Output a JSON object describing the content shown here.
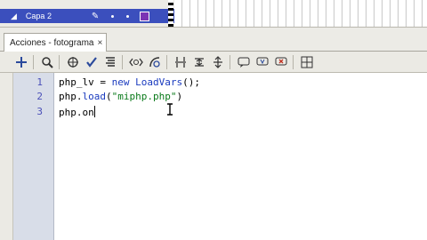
{
  "timeline": {
    "layer_name": "Capa 2"
  },
  "panel": {
    "tab_label": "Acciones - fotograma",
    "tab_close": "×"
  },
  "toolbar": {
    "icons": [
      "add-statement-icon",
      "find-icon",
      "target-icon",
      "check-syntax-icon",
      "auto-format-icon",
      "code-hint-icon",
      "debug-options-icon",
      "collapse-braces-icon",
      "collapse-selection-icon",
      "expand-all-icon",
      "apply-block-comment-icon",
      "apply-line-comment-icon",
      "remove-comment-icon",
      "show-toolbox-icon"
    ]
  },
  "editor": {
    "lines": [
      {
        "num": "1",
        "parts": [
          "php_lv",
          " = ",
          "new",
          " ",
          "LoadVars",
          "();"
        ]
      },
      {
        "num": "2",
        "parts": [
          "php.",
          "load",
          "(",
          "\"miphp.php\"",
          ")"
        ]
      },
      {
        "num": "3",
        "parts": [
          "php.on"
        ]
      }
    ]
  },
  "colors": {
    "layer_highlight": "#3b4fbd",
    "keyword": "#1a3bbf",
    "string": "#0a7a1a",
    "gutter": "#d8dde8"
  }
}
